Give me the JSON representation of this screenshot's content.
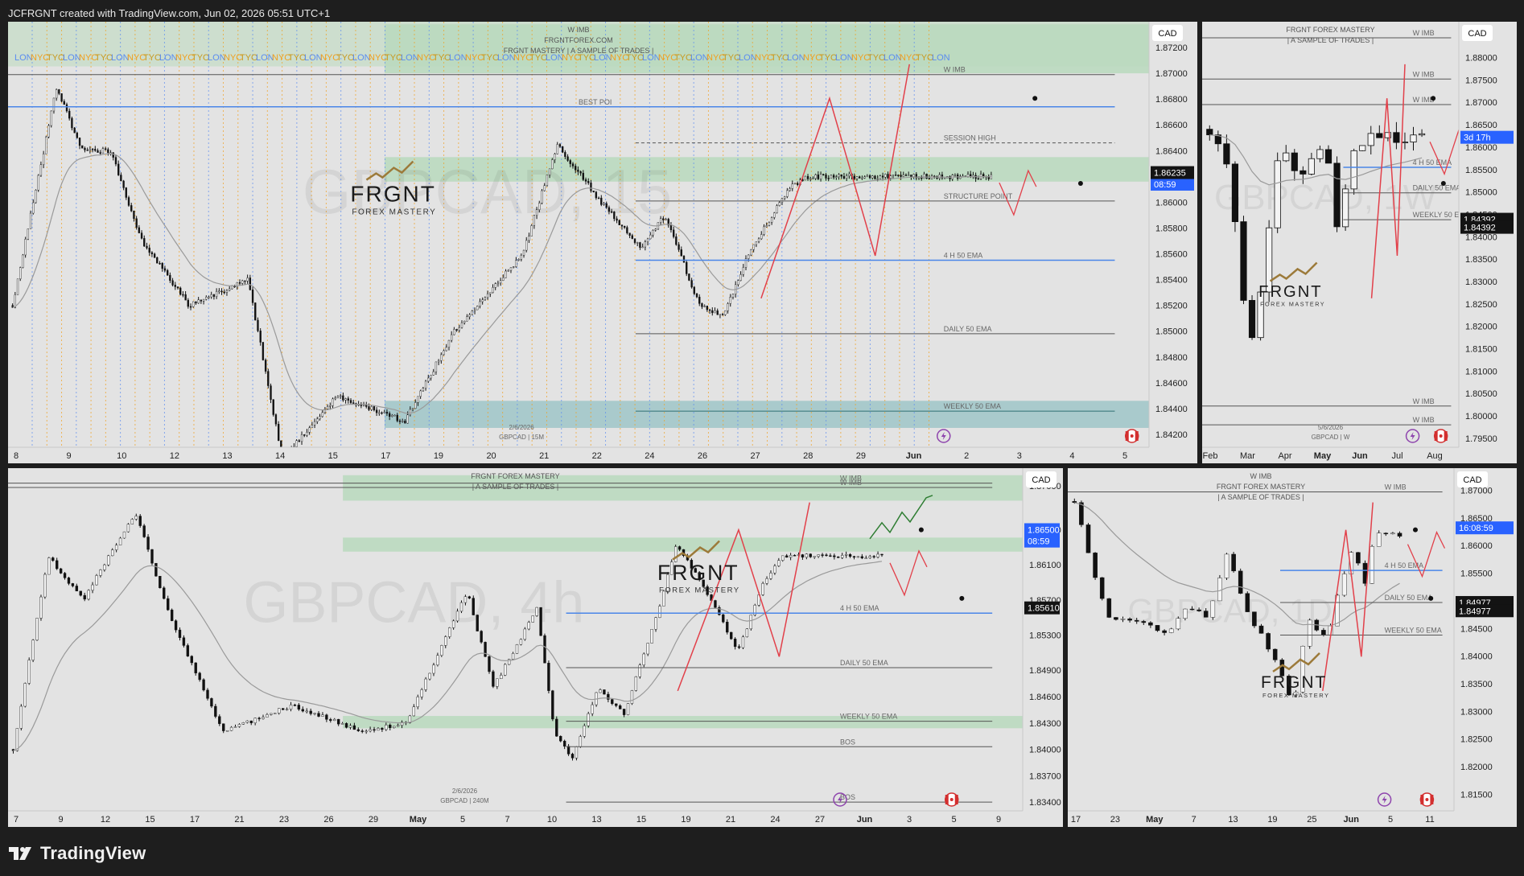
{
  "header": {
    "text": "JCFRGNT created with TradingView.com, Jun 02, 2026 05:51 UTC+1"
  },
  "footer": {
    "brand": "TradingView"
  },
  "colors": {
    "background": "#1e1e1e",
    "panel": "#e3e3e3",
    "candle": "#111111",
    "ema": "#9a9a9a",
    "green_zone": "#b9d9bd",
    "teal_zone": "#9fc6c8",
    "blue_line": "#4a86e8",
    "red_path": "#e2404a",
    "green_path": "#2e7d32",
    "price_tag_blue": "#2962ff",
    "price_tag_dark": "#131313",
    "session_lon": "#5b8cf0",
    "session_ny": "#f0a020"
  },
  "icons": [
    "lightning-icon",
    "canada-flag-icon",
    "tradingview-logo-icon"
  ],
  "chart_data": [
    {
      "id": "p1",
      "type": "candlestick",
      "symbol_watermark": "GBPCAD, 15",
      "currency": "CAD",
      "ylim": [
        1.841,
        1.874
      ],
      "y_ticks": [
        "1.87200",
        "1.87000",
        "1.86800",
        "1.86600",
        "1.86400",
        "1.86200",
        "1.86000",
        "1.85800",
        "1.85600",
        "1.85400",
        "1.85200",
        "1.85000",
        "1.84800",
        "1.84600",
        "1.84400",
        "1.84200"
      ],
      "x_ticks": [
        "8",
        "9",
        "10",
        "12",
        "13",
        "14",
        "15",
        "17",
        "19",
        "20",
        "21",
        "22",
        "24",
        "26",
        "27",
        "28",
        "29",
        "Jun",
        "2",
        "3",
        "4",
        "5"
      ],
      "price_tags": [
        {
          "text": "08:59",
          "value": 1.8614,
          "style": "blue"
        },
        {
          "text": "1.86235",
          "value": 1.8623,
          "style": "dark"
        }
      ],
      "top_texts": [
        "W IMB",
        "FRGNTFOREX.COM",
        "FRGNT MASTERY  |  A SAMPLE OF TRADES  |"
      ],
      "sessions": [
        "LON",
        "NYC",
        "TYO"
      ],
      "levels": [
        {
          "label": "W IMB",
          "value": 1.8699
        },
        {
          "label": "BEST POI",
          "value": 1.8674
        },
        {
          "label": "SESSION HIGH",
          "value": 1.8646
        },
        {
          "label": "STRUCTURE POINT",
          "value": 1.8601
        },
        {
          "label": "4 H 50 EMA",
          "value": 1.8555
        },
        {
          "label": "DAILY 50 EMA",
          "value": 1.8498
        },
        {
          "label": "WEEKLY 50 EMA",
          "value": 1.8438
        }
      ],
      "zones": [
        {
          "from": 1.87,
          "to": 1.8738,
          "color": "green"
        },
        {
          "from": 1.8616,
          "to": 1.8635,
          "color": "green"
        },
        {
          "from": 1.8425,
          "to": 1.8446,
          "color": "teal"
        }
      ],
      "footnote": [
        "2/6/2026",
        "GBPCAD | 15M"
      ],
      "brand": {
        "name": "FRGNT",
        "sub": "FOREX MASTERY"
      }
    },
    {
      "id": "p2",
      "type": "candlestick",
      "symbol_watermark": "GBPCAD, 1W",
      "currency": "CAD",
      "ylim": [
        1.793,
        1.888
      ],
      "y_ticks": [
        "1.88000",
        "1.87500",
        "1.87000",
        "1.86500",
        "1.86000",
        "1.85500",
        "1.85000",
        "1.84500",
        "1.84000",
        "1.83500",
        "1.83000",
        "1.82500",
        "1.82000",
        "1.81500",
        "1.81000",
        "1.80500",
        "1.80000",
        "1.79500"
      ],
      "x_ticks": [
        "Feb",
        "Mar",
        "Apr",
        "May",
        "Jun",
        "Jul",
        "Aug"
      ],
      "price_tags": [
        {
          "text": "3d 17h",
          "value": 1.8622,
          "style": "blue"
        },
        {
          "text": "1.84392",
          "value": 1.8439,
          "style": "dark"
        },
        {
          "text": "1.84392",
          "value": 1.8421,
          "style": "dark"
        }
      ],
      "top_texts": [
        "FRGNT FOREX MASTERY",
        "|  A SAMPLE OF TRADES  |"
      ],
      "levels": [
        {
          "label": "W IMB",
          "value": 1.8844
        },
        {
          "label": "W IMB",
          "value": 1.8752
        },
        {
          "label": "W IMB",
          "value": 1.8695
        },
        {
          "label": "4 H 50 EMA",
          "value": 1.8555
        },
        {
          "label": "DAILY 50 EMA",
          "value": 1.8498
        },
        {
          "label": "WEEKLY 50 EMA",
          "value": 1.8438
        },
        {
          "label": "W IMB",
          "value": 1.8022
        },
        {
          "label": "W IMB",
          "value": 1.798
        }
      ],
      "footnote": [
        "5/6/2026",
        "GBPCAD | W"
      ],
      "brand": {
        "name": "FRGNT",
        "sub": "FOREX MASTERY"
      }
    },
    {
      "id": "p3",
      "type": "candlestick",
      "symbol_watermark": "GBPCAD, 4h",
      "currency": "CAD",
      "ylim": [
        1.833,
        1.872
      ],
      "y_ticks": [
        "1.87000",
        "1.86500",
        "1.86100",
        "1.85700",
        "1.85300",
        "1.84900",
        "1.84600",
        "1.84300",
        "1.84000",
        "1.83700",
        "1.83400"
      ],
      "x_ticks": [
        "7",
        "9",
        "12",
        "15",
        "17",
        "21",
        "23",
        "26",
        "29",
        "May",
        "5",
        "7",
        "10",
        "13",
        "15",
        "19",
        "21",
        "24",
        "27",
        "Jun",
        "3",
        "5",
        "9"
      ],
      "price_tags": [
        {
          "text": "1.86500",
          "value": 1.865,
          "style": "blue"
        },
        {
          "text": "08:59",
          "value": 1.8637,
          "style": "blue"
        },
        {
          "text": "1.85610",
          "value": 1.8561,
          "style": "dark"
        }
      ],
      "top_texts": [
        "FRGNT FOREX MASTERY",
        "|  A SAMPLE OF TRADES  |"
      ],
      "levels": [
        {
          "label": "W IMB",
          "value": 1.8703
        },
        {
          "label": "W IMB",
          "value": 1.8698
        },
        {
          "label": "4 H 50 EMA",
          "value": 1.8555
        },
        {
          "label": "DAILY 50 EMA",
          "value": 1.8493
        },
        {
          "label": "WEEKLY 50 EMA",
          "value": 1.8432
        },
        {
          "label": "BOS",
          "value": 1.8403
        },
        {
          "label": "BOS",
          "value": 1.834
        }
      ],
      "zones": [
        {
          "from": 1.8683,
          "to": 1.8712,
          "color": "green"
        },
        {
          "from": 1.8625,
          "to": 1.8641,
          "color": "green"
        },
        {
          "from": 1.8424,
          "to": 1.8438,
          "color": "green"
        }
      ],
      "footnote": [
        "2/6/2026",
        "GBPCAD | 240M"
      ],
      "brand": {
        "name": "FRGNT",
        "sub": "FOREX MASTERY"
      }
    },
    {
      "id": "p4",
      "type": "candlestick",
      "symbol_watermark": "GBPCAD, 1D",
      "currency": "CAD",
      "ylim": [
        1.812,
        1.874
      ],
      "y_ticks": [
        "1.87000",
        "1.86500",
        "1.86000",
        "1.85500",
        "1.85000",
        "1.84500",
        "1.84000",
        "1.83500",
        "1.83000",
        "1.82500",
        "1.82000",
        "1.81500"
      ],
      "x_ticks": [
        "17",
        "23",
        "May",
        "7",
        "13",
        "19",
        "25",
        "Jun",
        "5",
        "11"
      ],
      "price_tags": [
        {
          "text": "16:08:59",
          "value": 1.8632,
          "style": "blue"
        },
        {
          "text": "1.84977",
          "value": 1.8497,
          "style": "dark"
        },
        {
          "text": "1.84977",
          "value": 1.8482,
          "style": "dark"
        }
      ],
      "top_texts": [
        "W IMB",
        "FRGNT FOREX MASTERY",
        "|  A SAMPLE OF TRADES  |"
      ],
      "levels": [
        {
          "label": "W IMB",
          "value": 1.8697
        },
        {
          "label": "4 H 50 EMA",
          "value": 1.8555
        },
        {
          "label": "DAILY 50 EMA",
          "value": 1.8497
        },
        {
          "label": "WEEKLY 50 EMA",
          "value": 1.8438
        }
      ],
      "brand": {
        "name": "FRGNT",
        "sub": "FOREX MASTERY"
      }
    }
  ]
}
